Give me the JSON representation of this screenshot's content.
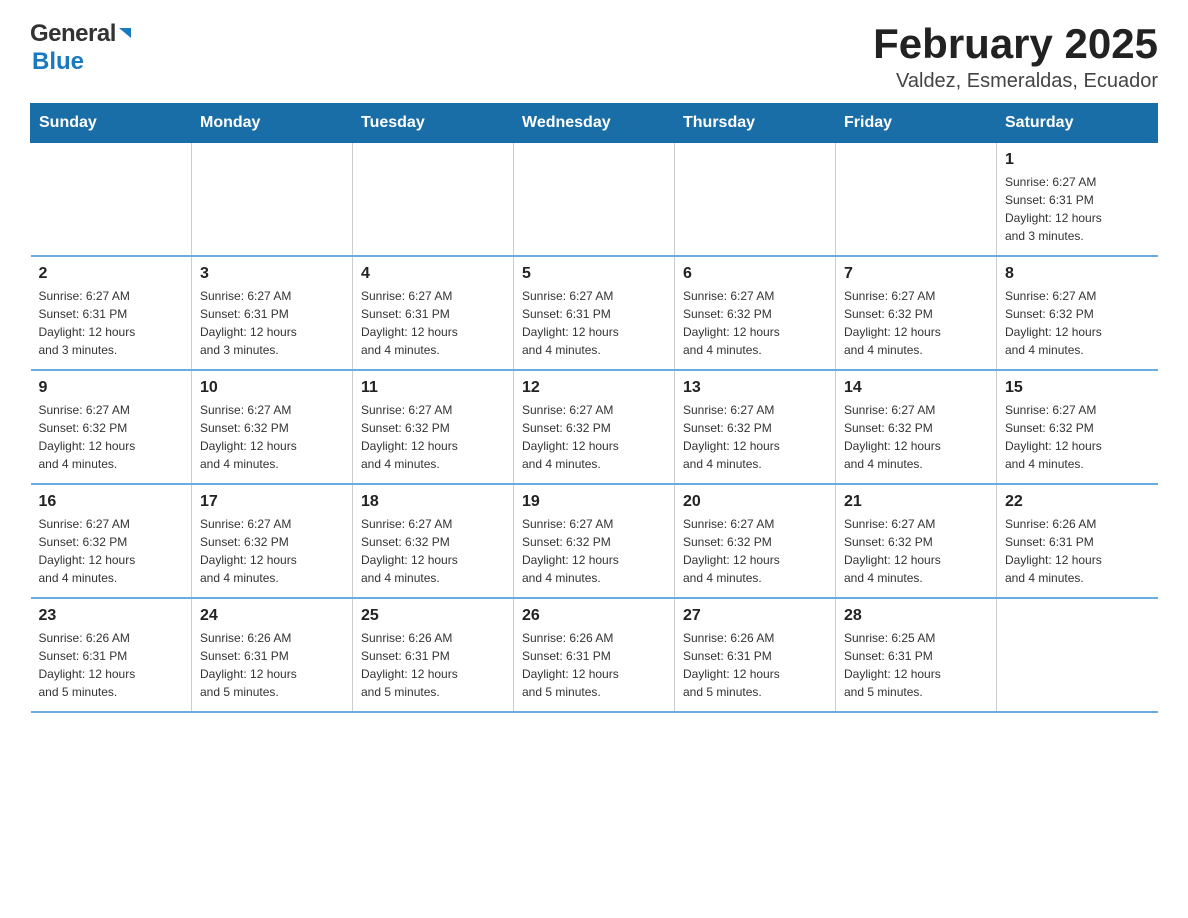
{
  "logo": {
    "general": "General",
    "blue": "Blue"
  },
  "title": {
    "month_year": "February 2025",
    "location": "Valdez, Esmeraldas, Ecuador"
  },
  "header": {
    "days": [
      "Sunday",
      "Monday",
      "Tuesday",
      "Wednesday",
      "Thursday",
      "Friday",
      "Saturday"
    ]
  },
  "weeks": [
    {
      "cells": [
        {
          "day": "",
          "info": ""
        },
        {
          "day": "",
          "info": ""
        },
        {
          "day": "",
          "info": ""
        },
        {
          "day": "",
          "info": ""
        },
        {
          "day": "",
          "info": ""
        },
        {
          "day": "",
          "info": ""
        },
        {
          "day": "1",
          "info": "Sunrise: 6:27 AM\nSunset: 6:31 PM\nDaylight: 12 hours\nand 3 minutes."
        }
      ]
    },
    {
      "cells": [
        {
          "day": "2",
          "info": "Sunrise: 6:27 AM\nSunset: 6:31 PM\nDaylight: 12 hours\nand 3 minutes."
        },
        {
          "day": "3",
          "info": "Sunrise: 6:27 AM\nSunset: 6:31 PM\nDaylight: 12 hours\nand 3 minutes."
        },
        {
          "day": "4",
          "info": "Sunrise: 6:27 AM\nSunset: 6:31 PM\nDaylight: 12 hours\nand 4 minutes."
        },
        {
          "day": "5",
          "info": "Sunrise: 6:27 AM\nSunset: 6:31 PM\nDaylight: 12 hours\nand 4 minutes."
        },
        {
          "day": "6",
          "info": "Sunrise: 6:27 AM\nSunset: 6:32 PM\nDaylight: 12 hours\nand 4 minutes."
        },
        {
          "day": "7",
          "info": "Sunrise: 6:27 AM\nSunset: 6:32 PM\nDaylight: 12 hours\nand 4 minutes."
        },
        {
          "day": "8",
          "info": "Sunrise: 6:27 AM\nSunset: 6:32 PM\nDaylight: 12 hours\nand 4 minutes."
        }
      ]
    },
    {
      "cells": [
        {
          "day": "9",
          "info": "Sunrise: 6:27 AM\nSunset: 6:32 PM\nDaylight: 12 hours\nand 4 minutes."
        },
        {
          "day": "10",
          "info": "Sunrise: 6:27 AM\nSunset: 6:32 PM\nDaylight: 12 hours\nand 4 minutes."
        },
        {
          "day": "11",
          "info": "Sunrise: 6:27 AM\nSunset: 6:32 PM\nDaylight: 12 hours\nand 4 minutes."
        },
        {
          "day": "12",
          "info": "Sunrise: 6:27 AM\nSunset: 6:32 PM\nDaylight: 12 hours\nand 4 minutes."
        },
        {
          "day": "13",
          "info": "Sunrise: 6:27 AM\nSunset: 6:32 PM\nDaylight: 12 hours\nand 4 minutes."
        },
        {
          "day": "14",
          "info": "Sunrise: 6:27 AM\nSunset: 6:32 PM\nDaylight: 12 hours\nand 4 minutes."
        },
        {
          "day": "15",
          "info": "Sunrise: 6:27 AM\nSunset: 6:32 PM\nDaylight: 12 hours\nand 4 minutes."
        }
      ]
    },
    {
      "cells": [
        {
          "day": "16",
          "info": "Sunrise: 6:27 AM\nSunset: 6:32 PM\nDaylight: 12 hours\nand 4 minutes."
        },
        {
          "day": "17",
          "info": "Sunrise: 6:27 AM\nSunset: 6:32 PM\nDaylight: 12 hours\nand 4 minutes."
        },
        {
          "day": "18",
          "info": "Sunrise: 6:27 AM\nSunset: 6:32 PM\nDaylight: 12 hours\nand 4 minutes."
        },
        {
          "day": "19",
          "info": "Sunrise: 6:27 AM\nSunset: 6:32 PM\nDaylight: 12 hours\nand 4 minutes."
        },
        {
          "day": "20",
          "info": "Sunrise: 6:27 AM\nSunset: 6:32 PM\nDaylight: 12 hours\nand 4 minutes."
        },
        {
          "day": "21",
          "info": "Sunrise: 6:27 AM\nSunset: 6:32 PM\nDaylight: 12 hours\nand 4 minutes."
        },
        {
          "day": "22",
          "info": "Sunrise: 6:26 AM\nSunset: 6:31 PM\nDaylight: 12 hours\nand 4 minutes."
        }
      ]
    },
    {
      "cells": [
        {
          "day": "23",
          "info": "Sunrise: 6:26 AM\nSunset: 6:31 PM\nDaylight: 12 hours\nand 5 minutes."
        },
        {
          "day": "24",
          "info": "Sunrise: 6:26 AM\nSunset: 6:31 PM\nDaylight: 12 hours\nand 5 minutes."
        },
        {
          "day": "25",
          "info": "Sunrise: 6:26 AM\nSunset: 6:31 PM\nDaylight: 12 hours\nand 5 minutes."
        },
        {
          "day": "26",
          "info": "Sunrise: 6:26 AM\nSunset: 6:31 PM\nDaylight: 12 hours\nand 5 minutes."
        },
        {
          "day": "27",
          "info": "Sunrise: 6:26 AM\nSunset: 6:31 PM\nDaylight: 12 hours\nand 5 minutes."
        },
        {
          "day": "28",
          "info": "Sunrise: 6:25 AM\nSunset: 6:31 PM\nDaylight: 12 hours\nand 5 minutes."
        },
        {
          "day": "",
          "info": ""
        }
      ]
    }
  ]
}
